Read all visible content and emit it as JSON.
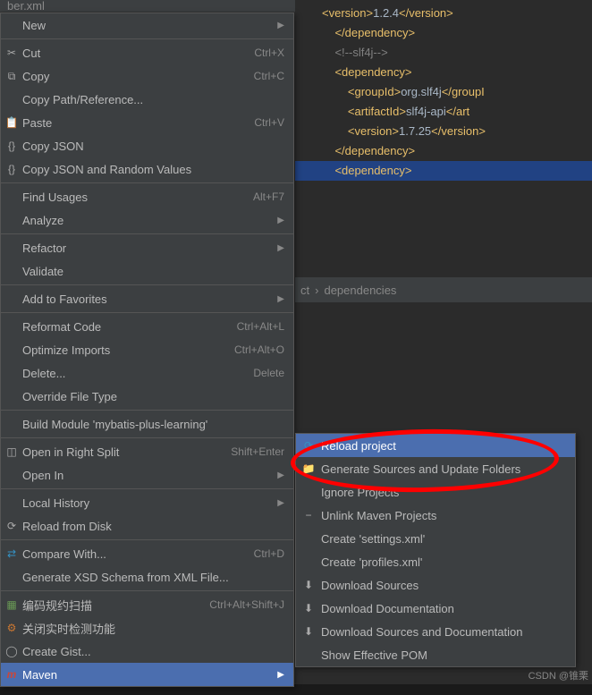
{
  "tab": {
    "filename": "ber.xml"
  },
  "menu": {
    "new": "New",
    "cut": "Cut",
    "cut_sc": "Ctrl+X",
    "copy": "Copy",
    "copy_sc": "Ctrl+C",
    "copy_path": "Copy Path/Reference...",
    "paste": "Paste",
    "paste_sc": "Ctrl+V",
    "copy_json": "Copy JSON",
    "copy_json_rand": "Copy JSON and Random Values",
    "find_usages": "Find Usages",
    "find_usages_sc": "Alt+F7",
    "analyze": "Analyze",
    "refactor": "Refactor",
    "validate": "Validate",
    "add_fav": "Add to Favorites",
    "reformat": "Reformat Code",
    "reformat_sc": "Ctrl+Alt+L",
    "optimize": "Optimize Imports",
    "optimize_sc": "Ctrl+Alt+O",
    "delete": "Delete...",
    "delete_sc": "Delete",
    "override_ft": "Override File Type",
    "build_module": "Build Module 'mybatis-plus-learning'",
    "split": "Open in Right Split",
    "split_sc": "Shift+Enter",
    "open_in": "Open In",
    "local_history": "Local History",
    "reload_disk": "Reload from Disk",
    "compare": "Compare With...",
    "compare_sc": "Ctrl+D",
    "gen_xsd": "Generate XSD Schema from XML File...",
    "code_scan": "编码规约扫描",
    "code_scan_sc": "Ctrl+Alt+Shift+J",
    "close_rt": "关闭实时检测功能",
    "create_gist": "Create Gist...",
    "maven": "Maven"
  },
  "submenu": {
    "reload_project": "Reload project",
    "gen_sources": "Generate Sources and Update Folders",
    "ignore_projects": "Ignore Projects",
    "unlink_maven": "Unlink Maven Projects",
    "create_settings": "Create 'settings.xml'",
    "create_profiles": "Create 'profiles.xml'",
    "download_src": "Download Sources",
    "download_doc": "Download Documentation",
    "download_both": "Download Sources and Documentation",
    "show_pom": "Show Effective POM"
  },
  "code": {
    "l0": "            <version>1.2.4</version>",
    "l1": "        </dependency>",
    "l2": "",
    "l3": "        <!--slf4j-->",
    "l4": "        <dependency>",
    "l5": "            <groupId>org.slf4j</groupI",
    "l6": "            <artifactId>slf4j-api</art",
    "l7": "            <version>1.7.25</version>",
    "l8": "        </dependency>",
    "l9": "",
    "l10": "        <dependency>"
  },
  "crumbs": {
    "ct": "ct",
    "deps": "dependencies"
  },
  "watermark": "CSDN @锥栗"
}
